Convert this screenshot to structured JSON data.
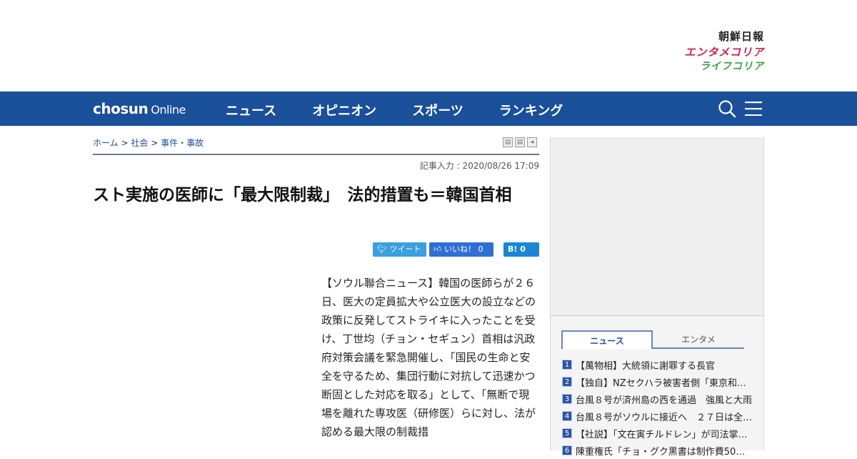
{
  "brands": {
    "chosun": "朝鮮日報",
    "enta": "エンタメコリア",
    "life": "ライフコリア"
  },
  "nav": {
    "logo_main": "chosun",
    "logo_sub": "Online",
    "menu": [
      "ニュース",
      "オピニオン",
      "スポーツ",
      "ランキング"
    ]
  },
  "breadcrumb": {
    "home": "ホーム",
    "sep": ">",
    "section": "社会",
    "sub": "事件・事故"
  },
  "article": {
    "date": "記事入力 : 2020/08/26 17:09",
    "headline": "スト実施の医師に「最大限制裁」　法的措置も＝韓国首相",
    "body": "【ソウル聯合ニュース】韓国の医師らが２６日、医大の定員拡大や公立医大の設立などの政策に反発してストライキに入ったことを受け、丁世均（チョン・セギュン）首相は汎政府対策会議を緊急開催し、「国民の生命と安全を守るため、集団行動に対抗して迅速かつ断固とした対応を取る」として、「無断で現場を離れた専攻医（研修医）らに対し、法が認める最大限の制裁措"
  },
  "social": {
    "tweet": "ツイート",
    "like": "いいね！ 0",
    "hatena": "B! 0"
  },
  "sidebar": {
    "tabs": [
      "ニュース",
      "エンタメ"
    ],
    "news": [
      {
        "num": "1",
        "title": "【萬物相】大統領に謝罪する長官"
      },
      {
        "num": "2",
        "title": "【独自】NZセクハラ被害者側「東京和解後…"
      },
      {
        "num": "3",
        "title": "台風８号が済州島の西を通過　強風と大雨"
      },
      {
        "num": "4",
        "title": "台風８号がソウルに接近へ　２７日は全国…"
      },
      {
        "num": "5",
        "title": "【社説】「文在寅チルドレン」が司法掌握…"
      },
      {
        "num": "6",
        "title": "陳重権氏「チョ・グク黒書は制作費50…"
      }
    ]
  },
  "colors": {
    "nav_bg": "#1a4f9a",
    "tweet": "#3b9ede",
    "like": "#2f6fd5",
    "hatena": "#1a86d6"
  }
}
